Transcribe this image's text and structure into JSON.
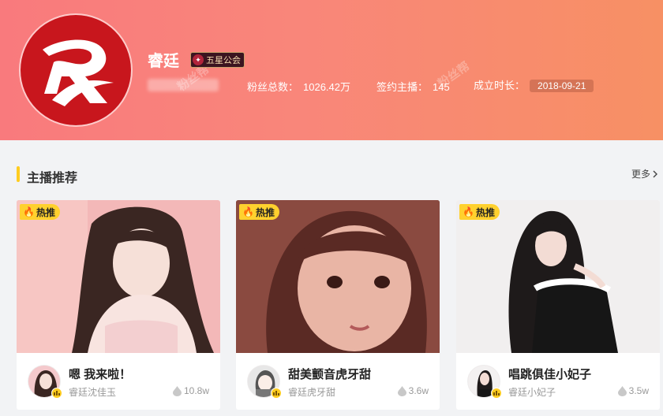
{
  "guild": {
    "name": "睿廷",
    "badge": "五星公会",
    "fans_label": "粉丝总数：",
    "fans_value": "1026.42万",
    "anchors_label": "签约主播：",
    "anchors_value": "145",
    "founded_label": "成立时长：",
    "founded_value": "2018-09-21",
    "watermark": "粉丝帮"
  },
  "section": {
    "title": "主播推荐",
    "more": "更多"
  },
  "cards": [
    {
      "tag": "热推",
      "title": "嗯 我来啦！",
      "anchor": "睿廷沈佳玉",
      "heat": "10.8w"
    },
    {
      "tag": "热推",
      "title": "甜美颤音虎牙甜",
      "anchor": "睿廷虎牙甜",
      "heat": "3.6w"
    },
    {
      "tag": "热推",
      "title": "唱跳俱佳小妃子",
      "anchor": "睿廷小妃子",
      "heat": "3.5w"
    }
  ],
  "colors": {
    "banner_start": "#f97a7d",
    "banner_end": "#f79064",
    "accent_yellow": "#ffcc1f",
    "logo_red": "#c8161d"
  },
  "icons": [
    "guild-logo",
    "badge-icon",
    "fire-icon",
    "chevron-right-icon",
    "heat-icon",
    "mic-icon"
  ]
}
